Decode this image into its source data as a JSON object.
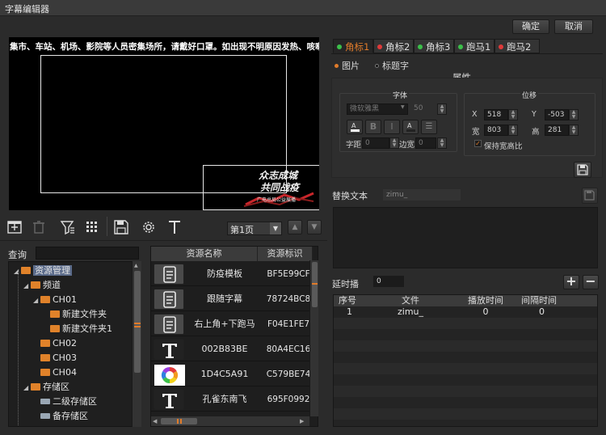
{
  "window": {
    "title": "字幕编辑器"
  },
  "actions": {
    "ok": "确定",
    "cancel": "取消"
  },
  "preview": {
    "ticker": "集市、车站、机场、影院等人员密集场所，请戴好口罩。如出现不明原因发热、咳嗽等症状",
    "logo_line1": "众志成城",
    "logo_line2": "共同战疫",
    "logo_sub": "广电总局公益展播"
  },
  "toolbar": {
    "icons": [
      "add-icon",
      "delete-icon",
      "filter-icon",
      "grid-icon",
      "save-icon",
      "settings-icon",
      "text-icon"
    ],
    "page": "第1页"
  },
  "query": {
    "label": "查询",
    "value": ""
  },
  "tree": {
    "items": [
      {
        "label": "资源管理",
        "level": 0,
        "type": "folder",
        "expanded": true
      },
      {
        "label": "频道",
        "level": 1,
        "type": "folder",
        "expanded": true
      },
      {
        "label": "CH01",
        "level": 2,
        "type": "folder",
        "expanded": true
      },
      {
        "label": "新建文件夹",
        "level": 3,
        "type": "folder",
        "expanded": false
      },
      {
        "label": "新建文件夹1",
        "level": 3,
        "type": "folder",
        "expanded": false
      },
      {
        "label": "CH02",
        "level": 2,
        "type": "folder",
        "expanded": false
      },
      {
        "label": "CH03",
        "level": 2,
        "type": "folder",
        "expanded": false
      },
      {
        "label": "CH04",
        "level": 2,
        "type": "folder",
        "expanded": false
      },
      {
        "label": "存储区",
        "level": 1,
        "type": "folder",
        "expanded": true
      },
      {
        "label": "二级存储区",
        "level": 2,
        "type": "drive",
        "expanded": false
      },
      {
        "label": "备存储区",
        "level": 2,
        "type": "drive",
        "expanded": false
      }
    ]
  },
  "resources": {
    "headers": [
      "资源名称",
      "资源标识"
    ],
    "rows": [
      {
        "icon": "document-icon",
        "name": "防疫模板",
        "id": "BF5E99CF"
      },
      {
        "icon": "document-icon",
        "name": "跟随字幕",
        "id": "78724BC8"
      },
      {
        "icon": "document-icon",
        "name": "右上角+下跑马",
        "id": "F04E1FE7"
      },
      {
        "icon": "text-t-icon",
        "name": "002B83BE",
        "id": "80A4EC16"
      },
      {
        "icon": "color-wheel-icon",
        "name": "1D4C5A91",
        "id": "C579BE74"
      },
      {
        "icon": "text-t-icon",
        "name": "孔雀东南飞",
        "id": "695F0992"
      }
    ]
  },
  "tabs": [
    {
      "label": "角标1",
      "color": "#3cc04a",
      "active": true
    },
    {
      "label": "角标2",
      "color": "#e03a3a",
      "active": false
    },
    {
      "label": "角标3",
      "color": "#3cc04a",
      "active": false
    },
    {
      "label": "跑马1",
      "color": "#3cc04a",
      "active": false
    },
    {
      "label": "跑马2",
      "color": "#e03a3a",
      "active": false
    }
  ],
  "mode": {
    "image": "图片",
    "title_text": "标题字",
    "selected": "image"
  },
  "properties": {
    "title": "属性",
    "font": {
      "title": "字体",
      "family": "微软雅黑",
      "size": "50",
      "spacing_label": "字距",
      "spacing": "0",
      "margin_label": "边宽",
      "margin": "0"
    },
    "position": {
      "title": "位移",
      "x_label": "X",
      "x": "518",
      "y_label": "Y",
      "y": "-503",
      "w_label": "宽",
      "w": "803",
      "h_label": "高",
      "h": "281",
      "keep_ratio": "保持宽高比",
      "keep_ratio_checked": true
    }
  },
  "replace_text": {
    "label": "替换文本",
    "value": "zimu_"
  },
  "delay": {
    "label": "延时播",
    "value": "0"
  },
  "playlist": {
    "headers": [
      "序号",
      "文件",
      "播放时间",
      "间隔时间"
    ],
    "rows": [
      {
        "no": "1",
        "file": "zimu_",
        "play": "0",
        "interval": "0"
      }
    ]
  }
}
